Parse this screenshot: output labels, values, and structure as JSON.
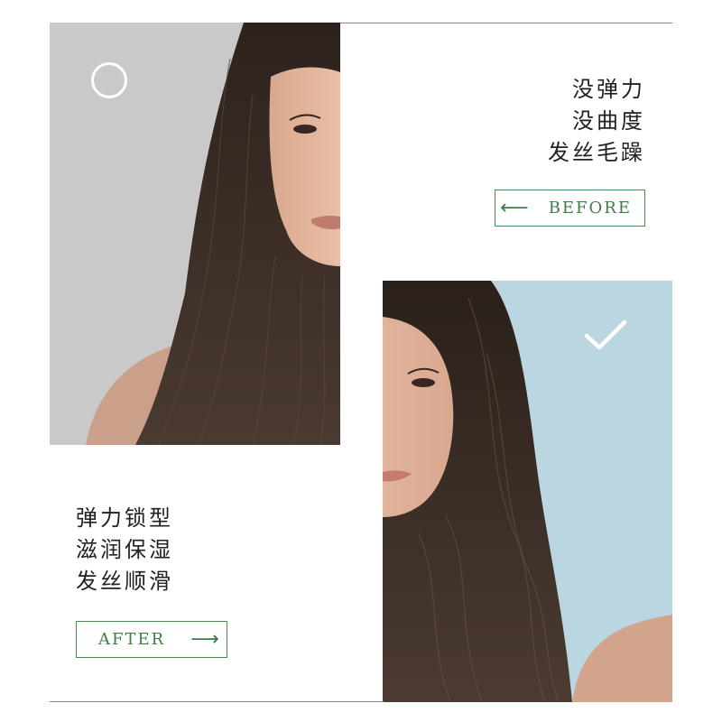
{
  "before": {
    "lines": [
      "没弹力",
      "没曲度",
      "发丝毛躁"
    ],
    "tag_label": "BEFORE",
    "arrow": "⟵",
    "status_icon": "circle-icon",
    "photo_bg": "#c9c9c9"
  },
  "after": {
    "lines": [
      "弹力锁型",
      "滋润保湿",
      "发丝顺滑"
    ],
    "tag_label": "AFTER",
    "arrow": "⟶",
    "status_icon": "check-icon",
    "photo_bg": "#b9d6e1"
  },
  "accent_color": "#3e7d46"
}
